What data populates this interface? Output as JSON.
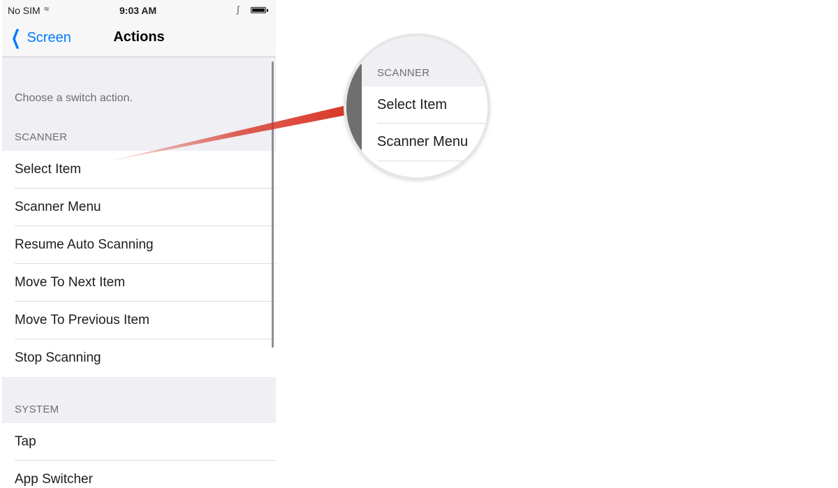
{
  "status_bar": {
    "carrier": "No SIM",
    "time": "9:03 AM"
  },
  "nav": {
    "back_label": "Screen",
    "title": "Actions"
  },
  "hint": "Choose a switch action.",
  "sections": {
    "scanner": {
      "header": "SCANNER",
      "items": [
        "Select Item",
        "Scanner Menu",
        "Resume Auto Scanning",
        "Move To Next Item",
        "Move To Previous Item",
        "Stop Scanning"
      ]
    },
    "system": {
      "header": "SYSTEM",
      "items": [
        "Tap",
        "App Switcher"
      ]
    }
  },
  "callout": {
    "header": "SCANNER",
    "items": [
      "Select Item",
      "Scanner Menu"
    ]
  },
  "colors": {
    "accent": "#007aff",
    "arrow": "#d62f1f"
  }
}
